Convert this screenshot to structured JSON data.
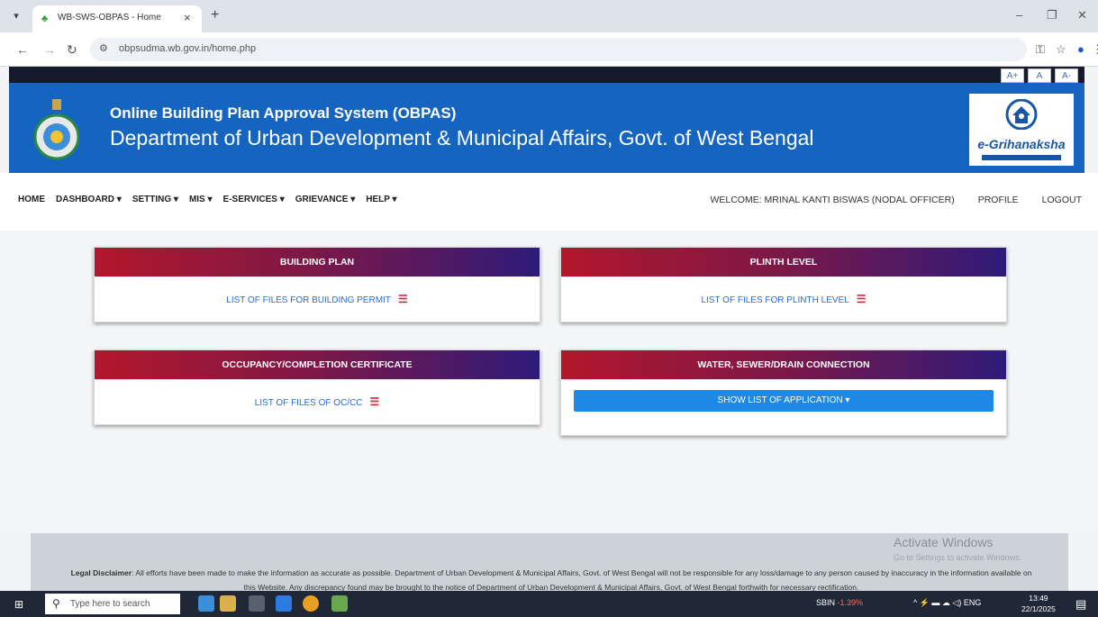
{
  "browser": {
    "tab_title": "WB-SWS-OBPAS - Home",
    "url": "obpsudma.wb.gov.in/home.php"
  },
  "site": {
    "font_controls": [
      "A+",
      "A",
      "A-"
    ],
    "title_line1": "Online Building Plan Approval System (OBPAS)",
    "title_line2": "Department of Urban Development & Municipal Affairs, Govt. of West Bengal",
    "logo_text": "e-Grihanaksha"
  },
  "menu": {
    "items": [
      "HOME",
      "DASHBOARD ▾",
      "SETTING ▾",
      "MIS ▾",
      "E-SERVICES ▾",
      "GRIEVANCE ▾",
      "HELP ▾"
    ],
    "welcome": "WELCOME: MRINAL KANTI BISWAS (NODAL OFFICER)",
    "profile": "PROFILE",
    "logout": "LOGOUT"
  },
  "cards": [
    {
      "title": "BUILDING PLAN",
      "link": "LIST OF FILES FOR BUILDING PERMIT"
    },
    {
      "title": "PLINTH LEVEL",
      "link": "LIST OF FILES FOR PLINTH LEVEL"
    },
    {
      "title": "OCCUPANCY/COMPLETION CERTIFICATE",
      "link": "LIST OF FILES OF OC/CC"
    },
    {
      "title": "WATER, SEWER/DRAIN CONNECTION",
      "button": "SHOW LIST OF APPLICATION ▾"
    }
  ],
  "footer": {
    "activate_title": "Activate Windows",
    "activate_sub": "Go to Settings to activate Windows.",
    "disclaimer_label": "Legal Disclaimer",
    "disclaimer_text": ": All efforts have been made to make the information as accurate as possible. Department of Urban Development & Municipal Affairs, Govt. of West Bengal will not be responsible for any loss/damage to any person caused by inaccuracy in the information available on this Website. Any discrepancy found may be brought to the notice of Department of Urban Development & Municipal Affairs, Govt. of West Bengal forthwith for necessary rectification."
  },
  "taskbar": {
    "search_placeholder": "Type here to search",
    "stock_name": "SBIN",
    "stock_change": "-1.39%",
    "lang": "ENG",
    "time": "13:49",
    "date": "22/1/2025"
  },
  "colors": {
    "header_blue": "#1565c0",
    "card_gradient_start": "#b3172b",
    "card_gradient_end": "#2e1b7a",
    "link_blue": "#2a6bd1",
    "button_blue": "#1e88e5"
  }
}
